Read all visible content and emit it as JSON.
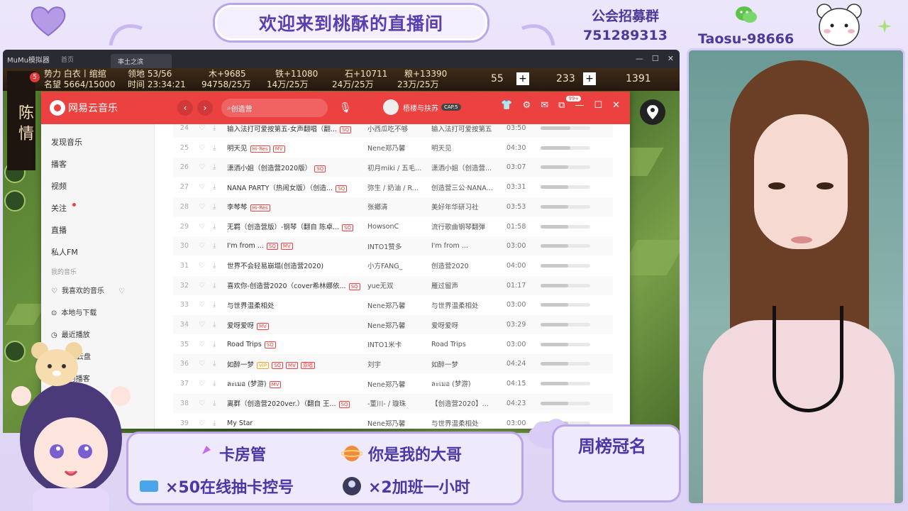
{
  "overlay": {
    "banner": "欢迎来到桃酥的直播间",
    "guild_title": "公会招募群",
    "guild_number": "751289313",
    "wechat_id": "Taosu-98666",
    "weekly_title": "周榜冠名",
    "rewards": [
      {
        "label": "卡房管"
      },
      {
        "label": "你是我的大哥"
      },
      {
        "label": "×50在线抽卡控号"
      },
      {
        "label": "×2加班一小时"
      }
    ]
  },
  "game": {
    "app_name": "MuMu模拟器",
    "home_tab": "首页",
    "active_tab": "率土之滨",
    "badge_count": "5",
    "player_name": "陈 情",
    "hud": {
      "faction": "势力 白衣丨绾绾",
      "reputation": "名望 5664/15000",
      "territory": "领地 53/56",
      "time": "时间 23:34:21",
      "wood": "木+9685",
      "wood_total": "94758/25万",
      "iron": "铁+11080",
      "iron_total": "14万/25万",
      "stone": "石+10711",
      "stone_total": "24万/25万",
      "grain": "粮+13390",
      "grain_total": "23万/25万",
      "jade": "55",
      "copper": "233",
      "gold": "1391"
    }
  },
  "music": {
    "app_name": "网易云音乐",
    "search_value": "创造营",
    "user_name": "梧楼与扶苏",
    "user_badge": "CAP.5",
    "msg_badge": "99+",
    "sidebar": [
      {
        "label": "发现音乐"
      },
      {
        "label": "播客"
      },
      {
        "label": "视频"
      },
      {
        "label": "关注"
      },
      {
        "label": "直播"
      },
      {
        "label": "私人FM"
      }
    ],
    "my_music_label": "我的音乐",
    "my_music": [
      {
        "label": "我喜欢的音乐"
      },
      {
        "label": "本地与下载"
      },
      {
        "label": "最近播放"
      },
      {
        "label": "音乐云盘"
      },
      {
        "label": "我的播客"
      }
    ],
    "songs": [
      {
        "idx": "24",
        "title": "输入法打可爱按第五-女声翻唱（翻...",
        "tags": [
          "SQ"
        ],
        "artist": "小西瓜吃不够",
        "album": "输入法打可爱按第五",
        "dur": "03:50",
        "pop": 0.6
      },
      {
        "idx": "25",
        "title": "明天见",
        "tags": [
          "Hi-Res",
          "MV"
        ],
        "artist": "Nene郑乃馨",
        "album": "明天见",
        "dur": "04:30",
        "pop": 0.6
      },
      {
        "idx": "26",
        "title": "潇洒小姐（创造营2020版）",
        "tags": [
          "SQ"
        ],
        "artist": "初月miki / 五毛...",
        "album": "潇洒小姐（创造营...",
        "dur": "03:07",
        "pop": 0.55
      },
      {
        "idx": "27",
        "title": "NANA PARTY（热闹女版）（创造...",
        "tags": [
          "SQ"
        ],
        "artist": "弥生 / 奶油 / R...",
        "album": "创造营三公·NANA...",
        "dur": "03:31",
        "pop": 0.55
      },
      {
        "idx": "28",
        "title": "李棽棽",
        "tags": [
          "Hi-Res"
        ],
        "artist": "张鄉清",
        "album": "美好年华研习社",
        "dur": "03:53",
        "pop": 0.55
      },
      {
        "idx": "29",
        "title": "无羁（创造营版）-钢琴（翻自 陈卓...",
        "tags": [
          "SQ"
        ],
        "artist": "HowsonC",
        "album": "流行歌曲钢琴翻弹",
        "dur": "01:58",
        "pop": 0.55
      },
      {
        "idx": "30",
        "title": "I'm from ...",
        "tags": [
          "SQ",
          "MV"
        ],
        "artist": "INTO1赞多",
        "album": "I'm from ...",
        "dur": "03:00",
        "pop": 0.55
      },
      {
        "idx": "31",
        "title": "世界不会轻易崩塌(创造营2020)",
        "tags": [],
        "artist": "小方FANG_",
        "album": "创造营2020",
        "dur": "04:00",
        "pop": 0.55
      },
      {
        "idx": "32",
        "title": "喜欢你-创造营2020（cover希林娜依...",
        "tags": [
          "SQ"
        ],
        "artist": "yue无双",
        "album": "雁过留声",
        "dur": "01:17",
        "pop": 0.55
      },
      {
        "idx": "33",
        "title": "与世界温柔相处",
        "tags": [],
        "artist": "Nene郑乃馨",
        "album": "与世界温柔相处",
        "dur": "03:00",
        "pop": 0.55
      },
      {
        "idx": "34",
        "title": "爱呀爱呀",
        "tags": [
          "MV"
        ],
        "artist": "Nene郑乃馨",
        "album": "爱呀爱呀",
        "dur": "03:29",
        "pop": 0.55
      },
      {
        "idx": "35",
        "title": "Road Trips",
        "tags": [
          "SQ"
        ],
        "artist": "INTO1米卡",
        "album": "Road Trips",
        "dur": "03:00",
        "pop": 0.55
      },
      {
        "idx": "36",
        "title": "如醉一梦",
        "tags": [
          "VIP",
          "SQ",
          "MV",
          "原唱"
        ],
        "artist": "刘宇",
        "album": "如醉一梦",
        "dur": "04:24",
        "pop": 0.55
      },
      {
        "idx": "37",
        "title": "ละเมอ (梦游)",
        "tags": [
          "MV"
        ],
        "artist": "Nene郑乃馨",
        "album": "ละเมอ (梦游)",
        "dur": "04:15",
        "pop": 0.55
      },
      {
        "idx": "38",
        "title": "离群（创造营2020ver.）（翻自 王...",
        "tags": [
          "SQ"
        ],
        "artist": "-董川- / 璇珠",
        "album": "【创造营2020】...",
        "dur": "04:23",
        "pop": 0.55
      },
      {
        "idx": "39",
        "title": "My Star",
        "tags": [],
        "artist": "Nene郑乃馨",
        "album": "与世界温柔相处",
        "dur": "03:00",
        "pop": 0.55
      }
    ]
  },
  "colors": {
    "netease_red": "#ec4141",
    "overlay_purple": "#b9a6ea",
    "overlay_text": "#4a37a6"
  }
}
